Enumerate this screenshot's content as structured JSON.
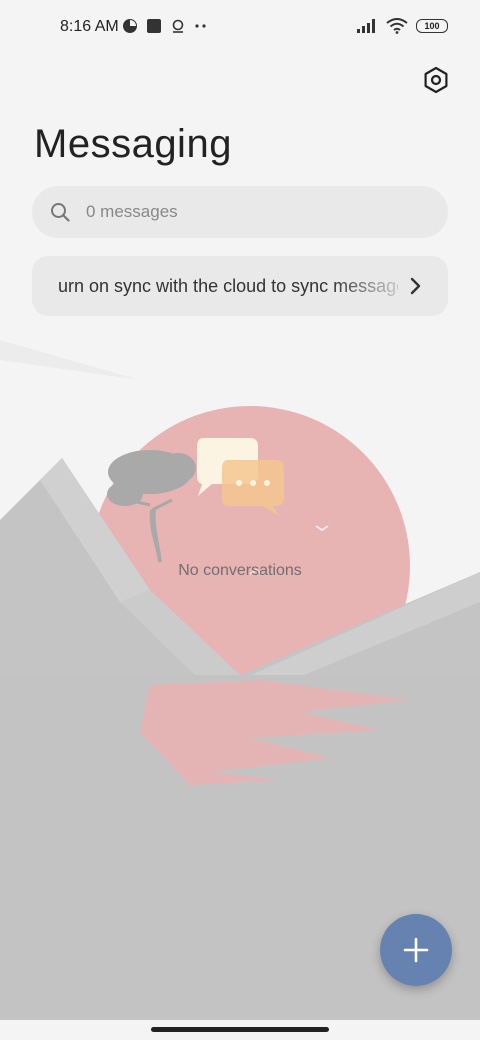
{
  "status_bar": {
    "time": "8:16 AM",
    "battery": "100",
    "left_icons": [
      "data-saver-icon",
      "square-notification-icon",
      "location-icon",
      "more-dots-icon"
    ],
    "right_icons": [
      "signal-icon",
      "wifi-icon",
      "battery-icon"
    ]
  },
  "header": {
    "title": "Messaging",
    "settings_icon": "settings-hexagon-icon"
  },
  "search": {
    "placeholder": "0 messages"
  },
  "sync_banner": {
    "text": "urn on sync with the cloud to sync messages"
  },
  "empty_state": {
    "text": "No conversations"
  },
  "fab": {
    "icon": "plus-icon",
    "color": "#6682b0"
  },
  "colors": {
    "background": "#f4f4f4",
    "sun": "#e8b3b3",
    "mountains": "#c4c4c4",
    "accent": "#6682b0"
  }
}
